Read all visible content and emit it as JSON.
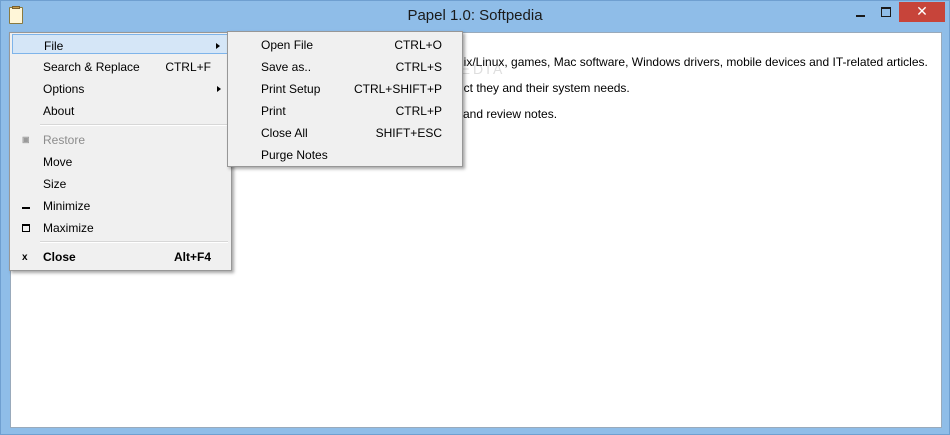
{
  "window": {
    "title": "Papel 1.0: Softpedia",
    "app_icon": "notepad-icon",
    "controls": {
      "minimize": "minimize-icon",
      "maximize": "maximize-icon",
      "close": "close-icon",
      "close_glyph": "✕"
    }
  },
  "content": {
    "lines": [
      "nix/Linux, games, Mac software, Windows drivers, mobile devices and IT-related articles.",
      "uct they and their system needs.",
      "and review notes."
    ],
    "watermark": "SOFTPEDIA"
  },
  "system_menu": {
    "items": [
      {
        "label": "File",
        "shortcut": "",
        "has_submenu": true
      },
      {
        "label": "Search & Replace",
        "shortcut": "CTRL+F"
      },
      {
        "label": "Options",
        "shortcut": "",
        "has_submenu": true
      },
      {
        "label": "About",
        "shortcut": ""
      },
      {
        "label": "Restore",
        "shortcut": "",
        "disabled": true,
        "icon": "restore-icon"
      },
      {
        "label": "Move",
        "shortcut": ""
      },
      {
        "label": "Size",
        "shortcut": ""
      },
      {
        "label": "Minimize",
        "shortcut": "",
        "icon": "minimize-icon"
      },
      {
        "label": "Maximize",
        "shortcut": "",
        "icon": "maximize-icon"
      },
      {
        "label": "Close",
        "shortcut": "Alt+F4",
        "icon": "close-icon",
        "icon_glyph": "x"
      }
    ]
  },
  "file_submenu": {
    "items": [
      {
        "label": "Open File",
        "shortcut": "CTRL+O"
      },
      {
        "label": "Save as..",
        "shortcut": "CTRL+S"
      },
      {
        "label": "Print Setup",
        "shortcut": "CTRL+SHIFT+P"
      },
      {
        "label": "Print",
        "shortcut": "CTRL+P"
      },
      {
        "label": "Close All",
        "shortcut": "SHIFT+ESC"
      },
      {
        "label": "Purge Notes",
        "shortcut": ""
      }
    ]
  },
  "colors": {
    "title_bar": "#8fbde8",
    "close_button": "#c7443a",
    "menu_background": "#f0f0f0",
    "menu_highlight": "#d5e6f7",
    "menu_highlight_border": "#7eb4ea"
  }
}
